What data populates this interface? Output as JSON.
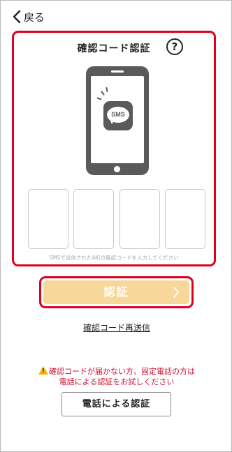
{
  "header": {
    "back_label": "戻る"
  },
  "verify_panel": {
    "title": "確認コード認証",
    "help_label": "?",
    "sms_icon_text": "SMS",
    "code_digits": [
      "",
      "",
      "",
      ""
    ],
    "hint": "SMSで送信された4桁の確認コードを入力してください"
  },
  "submit": {
    "label": "認証"
  },
  "resend": {
    "label": "確認コード再送信"
  },
  "warning": {
    "line1": "確認コードが届かない方、固定電話の方は",
    "line2": "電話による認証をお試しください"
  },
  "phone_verify": {
    "label": "電話による認証"
  },
  "colors": {
    "highlight_border": "#e0001b",
    "submit_disabled_bg": "#f8d79a",
    "warning_text": "#c8102e",
    "device_gray": "#5a5a5a"
  }
}
